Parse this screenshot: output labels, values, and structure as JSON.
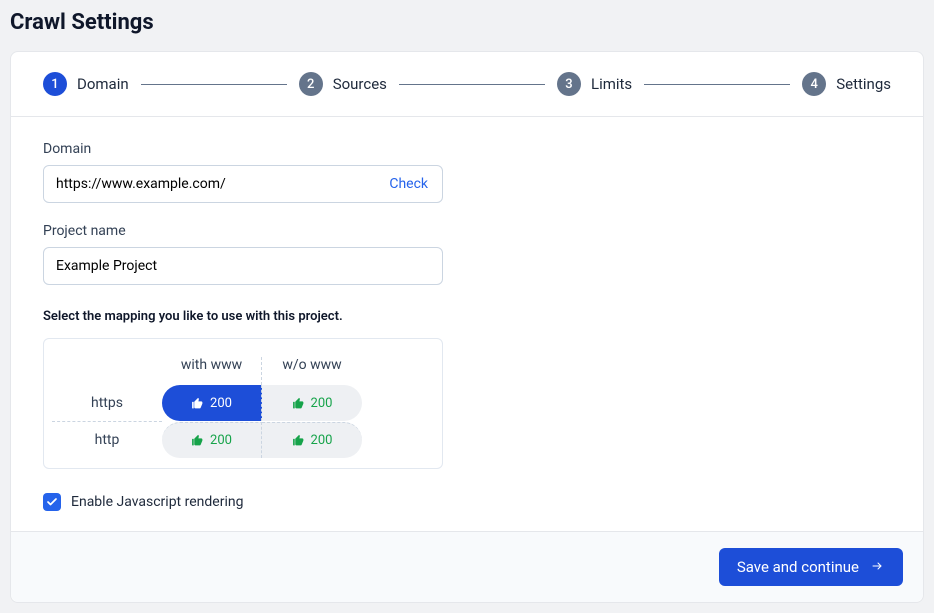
{
  "page": {
    "title": "Crawl Settings"
  },
  "stepper": {
    "steps": [
      {
        "num": "1",
        "label": "Domain",
        "active": true
      },
      {
        "num": "2",
        "label": "Sources",
        "active": false
      },
      {
        "num": "3",
        "label": "Limits",
        "active": false
      },
      {
        "num": "4",
        "label": "Settings",
        "active": false
      }
    ]
  },
  "form": {
    "domain_label": "Domain",
    "domain_value": "https://www.example.com/",
    "check_label": "Check",
    "project_label": "Project name",
    "project_value": "Example Project",
    "mapping_label": "Select the mapping you like to use with this project.",
    "mapping": {
      "col1": "with www",
      "col2": "w/o www",
      "row1": "https",
      "row2": "http",
      "cells": {
        "https_www": "200",
        "https_nowww": "200",
        "http_www": "200",
        "http_nowww": "200"
      }
    },
    "js_checkbox_label": "Enable Javascript rendering"
  },
  "footer": {
    "save_label": "Save and continue"
  }
}
